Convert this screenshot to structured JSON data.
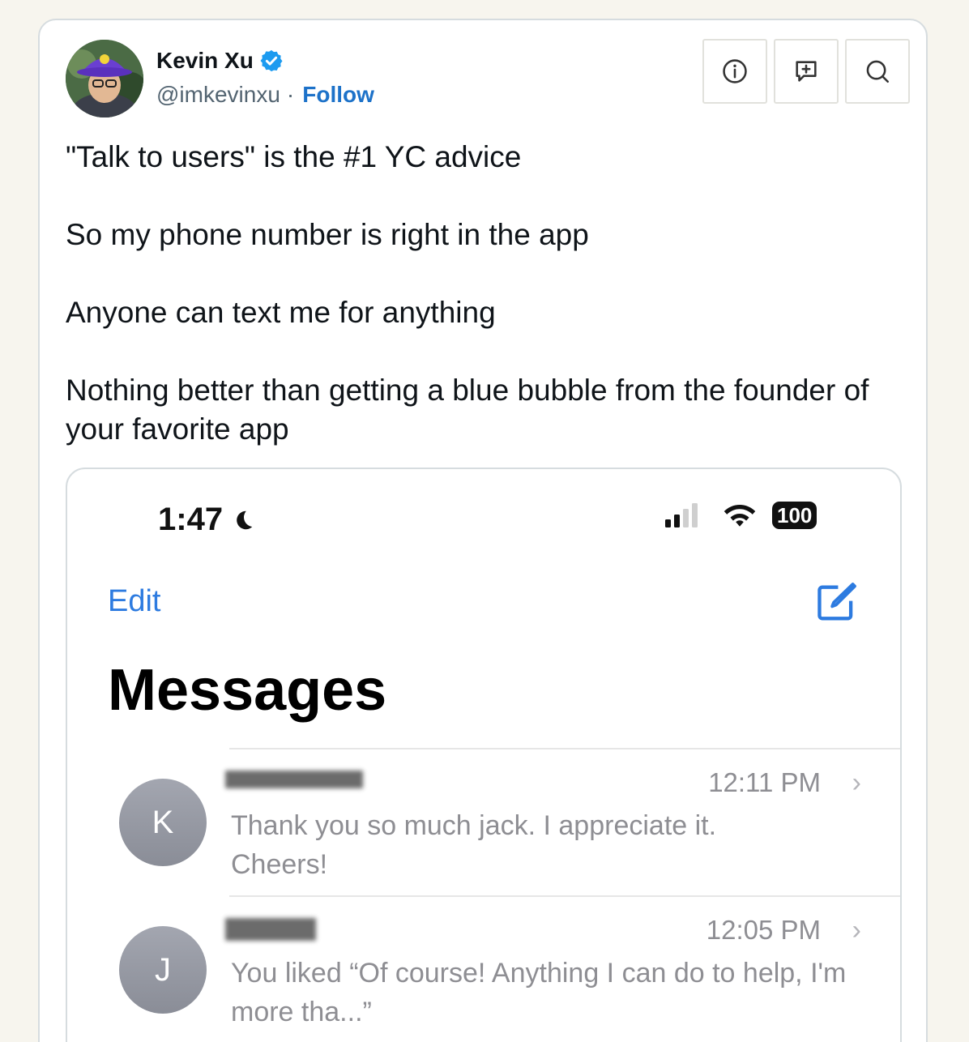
{
  "tweet": {
    "author": {
      "name": "Kevin Xu",
      "handle": "@imkevinxu",
      "separator": "·",
      "follow_label": "Follow",
      "verified": true
    },
    "actions": [
      {
        "icon": "info-icon"
      },
      {
        "icon": "reply-icon"
      },
      {
        "icon": "search-icon"
      }
    ],
    "text": [
      "\"Talk to users\" is the #1 YC advice",
      "So my phone number is right in the app",
      "Anyone can text me for anything",
      "Nothing better than getting a blue bubble from the founder of your favorite app"
    ],
    "colors": {
      "accent": "#1d72c9",
      "verified": "#1d9bf0"
    }
  },
  "screenshot": {
    "status_bar": {
      "time": "1:47",
      "battery": "100"
    },
    "edit_label": "Edit",
    "title": "Messages",
    "conversations": [
      {
        "initial": "K",
        "time": "12:11 PM",
        "preview": "Thank you so much jack. I appreciate it. Cheers!"
      },
      {
        "initial": "J",
        "time": "12:05 PM",
        "preview": "You liked “Of course! Anything I can do to help, I'm more tha...”"
      }
    ]
  }
}
